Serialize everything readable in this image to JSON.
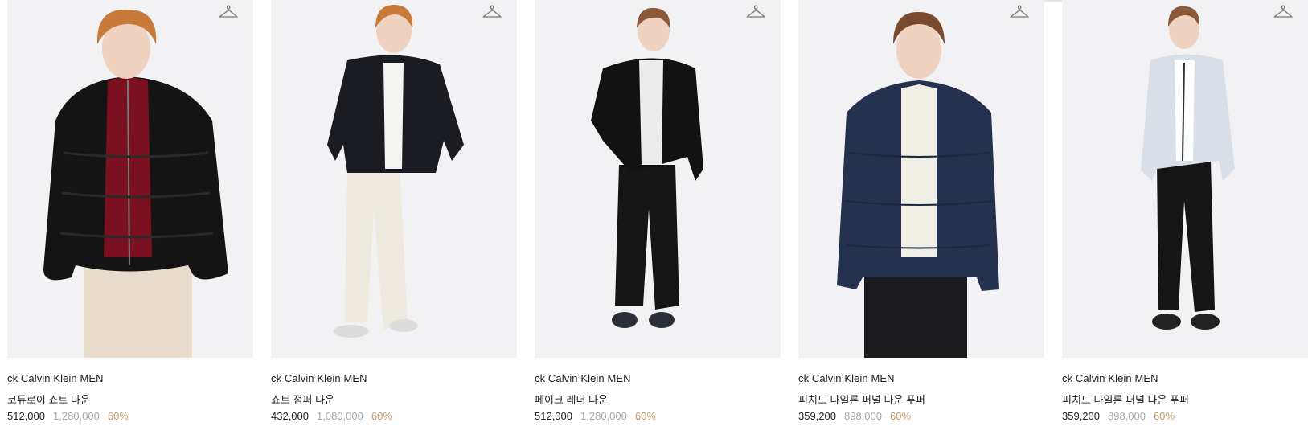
{
  "products": [
    {
      "brand": "ck Calvin Klein MEN",
      "name": "코듀로이 쇼트 다운",
      "price": "512,000",
      "original_price": "1,280,000",
      "discount": "60%",
      "colors": {
        "jacket": "#141414",
        "inner": "#7a1020",
        "pants": "#e8dccb",
        "hair": "#c77a3a"
      }
    },
    {
      "brand": "ck Calvin Klein MEN",
      "name": "쇼트 점퍼 다운",
      "price": "432,000",
      "original_price": "1,080,000",
      "discount": "60%",
      "colors": {
        "jacket": "#1a1c22",
        "inner": "#f4f4f2",
        "pants": "#efeae0",
        "hair": "#c77a3a"
      }
    },
    {
      "brand": "ck Calvin Klein MEN",
      "name": "페이크 레더 다운",
      "price": "512,000",
      "original_price": "1,280,000",
      "discount": "60%",
      "colors": {
        "jacket": "#121212",
        "inner": "#ececec",
        "pants": "#151515",
        "hair": "#8a5a3a"
      }
    },
    {
      "brand": "ck Calvin Klein MEN",
      "name": "피치드 나일론 퍼널 다운 푸퍼",
      "price": "359,200",
      "original_price": "898,000",
      "discount": "60%",
      "colors": {
        "jacket": "#25324f",
        "inner": "#f1eee6",
        "pants": "#1c1c1e",
        "hair": "#7a4a2e"
      }
    },
    {
      "brand": "ck Calvin Klein MEN",
      "name": "피치드 나일론 퍼널 다운 푸퍼",
      "price": "359,200",
      "original_price": "898,000",
      "discount": "60%",
      "colors": {
        "jacket": "#d8dfe6",
        "inner": "#ffffff",
        "pants": "#151515",
        "hair": "#8a5a3a"
      }
    }
  ],
  "icons": {
    "wishlist": "hanger-icon"
  },
  "accent": {
    "discount": "#c79a6a",
    "original_price": "#a8a8a8"
  }
}
